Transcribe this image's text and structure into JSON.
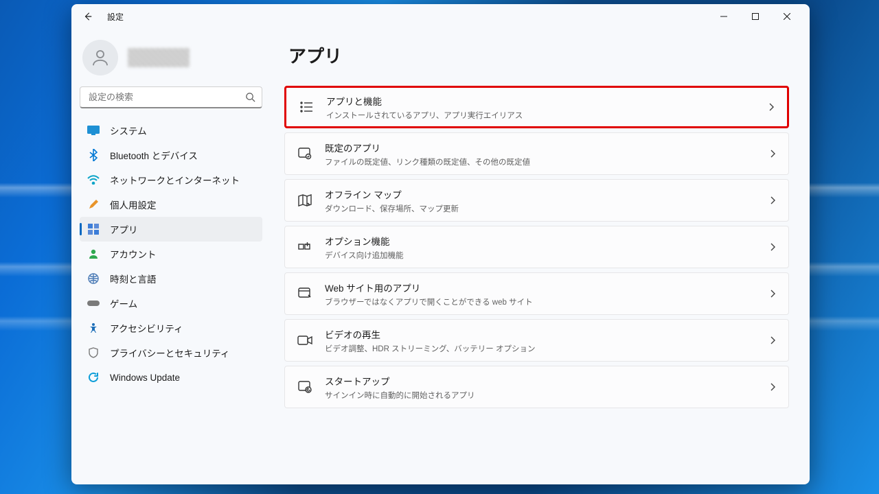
{
  "window": {
    "title": "設定"
  },
  "search": {
    "placeholder": "設定の検索"
  },
  "nav": [
    {
      "label": "システム"
    },
    {
      "label": "Bluetooth とデバイス"
    },
    {
      "label": "ネットワークとインターネット"
    },
    {
      "label": "個人用設定"
    },
    {
      "label": "アプリ"
    },
    {
      "label": "アカウント"
    },
    {
      "label": "時刻と言語"
    },
    {
      "label": "ゲーム"
    },
    {
      "label": "アクセシビリティ"
    },
    {
      "label": "プライバシーとセキュリティ"
    },
    {
      "label": "Windows Update"
    }
  ],
  "page": {
    "heading": "アプリ"
  },
  "cards": [
    {
      "title": "アプリと機能",
      "sub": "インストールされているアプリ、アプリ実行エイリアス"
    },
    {
      "title": "既定のアプリ",
      "sub": "ファイルの既定値、リンク種類の既定値、その他の既定値"
    },
    {
      "title": "オフライン マップ",
      "sub": "ダウンロード、保存場所、マップ更新"
    },
    {
      "title": "オプション機能",
      "sub": "デバイス向け追加機能"
    },
    {
      "title": "Web サイト用のアプリ",
      "sub": "ブラウザーではなくアプリで開くことができる web サイト"
    },
    {
      "title": "ビデオの再生",
      "sub": "ビデオ調整、HDR ストリーミング、バッテリー オプション"
    },
    {
      "title": "スタートアップ",
      "sub": "サインイン時に自動的に開始されるアプリ"
    }
  ]
}
